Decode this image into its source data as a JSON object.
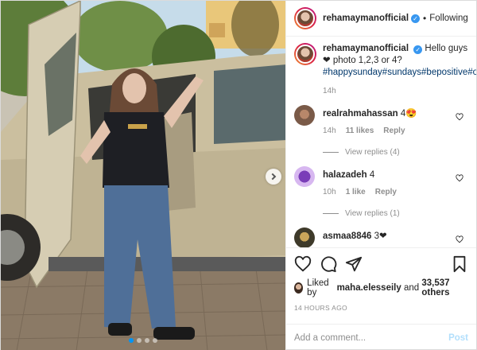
{
  "header": {
    "username": "rehamaymanofficial",
    "separator": "•",
    "follow_state": "Following"
  },
  "caption": {
    "username": "rehamaymanofficial",
    "text": "Hello guys ❤ photo 1,2,3 or 4?",
    "hashtags": "#happysunday#sundays#bepositive#ootd#loveyoall",
    "age": "14h"
  },
  "comments": [
    {
      "username": "realrahmahassan",
      "text": "4😍",
      "age": "14h",
      "likes": "11 likes",
      "reply": "Reply",
      "view_replies": "View replies (4)"
    },
    {
      "username": "halazadeh",
      "text": "4",
      "age": "10h",
      "likes": "1 like",
      "reply": "Reply",
      "view_replies": "View replies (1)"
    },
    {
      "username": "asmaa8846",
      "text": "3❤",
      "age": "",
      "likes": "",
      "reply": "",
      "view_replies": ""
    }
  ],
  "likes": {
    "prefix": "Liked by",
    "user": "maha.elesseily",
    "middle": "and",
    "count": "33,537 others"
  },
  "timestamp": "14 HOURS AGO",
  "add_comment": {
    "placeholder": "Add a comment...",
    "post_label": "Post"
  },
  "carousel": {
    "slides": 4,
    "active": 1
  },
  "colors": {
    "accent": "#0095f6",
    "verified": "#3897f0",
    "hashtag": "#00376b",
    "muted": "#8e8e8e"
  },
  "icons": [
    "heart-icon",
    "comment-icon",
    "share-icon",
    "bookmark-icon",
    "verified-icon",
    "chevron-right-icon"
  ]
}
